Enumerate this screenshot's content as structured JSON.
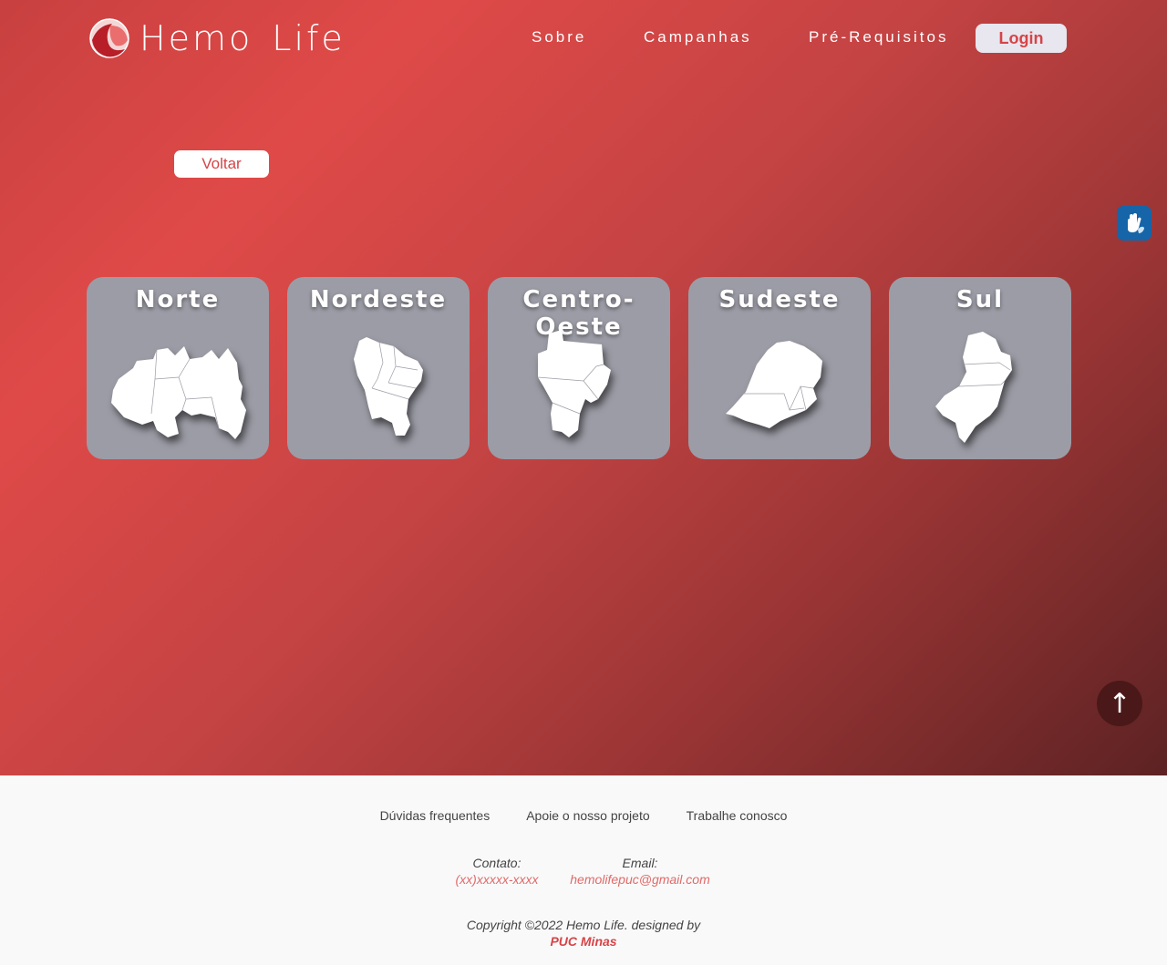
{
  "brand": {
    "name": "Hemo Life",
    "accent": "#d64448"
  },
  "nav": {
    "items": [
      "Sobre",
      "Campanhas",
      "Pré-Requisitos"
    ],
    "login": "Login"
  },
  "back_button": "Voltar",
  "regions": [
    {
      "name": "Norte",
      "icon": "norte-map-icon"
    },
    {
      "name": "Nordeste",
      "icon": "nordeste-map-icon"
    },
    {
      "name": "Centro-Oeste",
      "icon": "centro-oeste-map-icon"
    },
    {
      "name": "Sudeste",
      "icon": "sudeste-map-icon"
    },
    {
      "name": "Sul",
      "icon": "sul-map-icon"
    }
  ],
  "scroll_top_glyph": "↑",
  "footer": {
    "links": [
      "Dúvidas frequentes",
      "Apoie o nosso projeto",
      "Trabalhe conosco"
    ],
    "contact_label": "Contato:",
    "contact_value": "(xx)xxxxx-xxxx",
    "email_label": "Email:",
    "email_value": "hemolifepuc@gmail.com",
    "copyright": "Copyright ©2022 Hemo Life. designed by",
    "designer": "PUC Minas"
  }
}
